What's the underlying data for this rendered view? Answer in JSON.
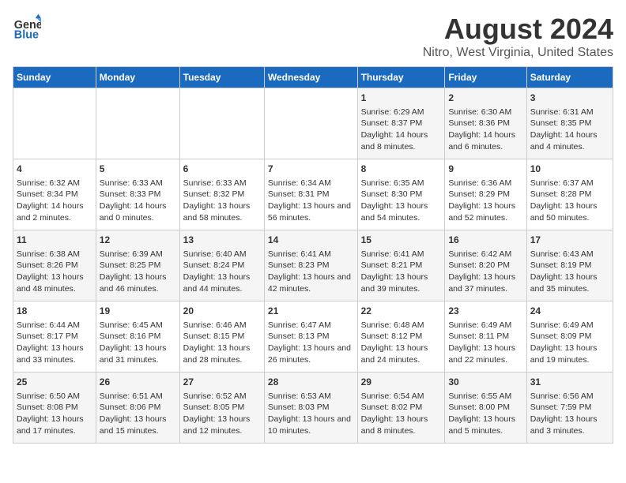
{
  "logo": {
    "line1": "General",
    "line2": "Blue"
  },
  "title": "August 2024",
  "subtitle": "Nitro, West Virginia, United States",
  "headers": [
    "Sunday",
    "Monday",
    "Tuesday",
    "Wednesday",
    "Thursday",
    "Friday",
    "Saturday"
  ],
  "weeks": [
    [
      {
        "day": "",
        "info": ""
      },
      {
        "day": "",
        "info": ""
      },
      {
        "day": "",
        "info": ""
      },
      {
        "day": "",
        "info": ""
      },
      {
        "day": "1",
        "info": "Sunrise: 6:29 AM\nSunset: 8:37 PM\nDaylight: 14 hours and 8 minutes."
      },
      {
        "day": "2",
        "info": "Sunrise: 6:30 AM\nSunset: 8:36 PM\nDaylight: 14 hours and 6 minutes."
      },
      {
        "day": "3",
        "info": "Sunrise: 6:31 AM\nSunset: 8:35 PM\nDaylight: 14 hours and 4 minutes."
      }
    ],
    [
      {
        "day": "4",
        "info": "Sunrise: 6:32 AM\nSunset: 8:34 PM\nDaylight: 14 hours and 2 minutes."
      },
      {
        "day": "5",
        "info": "Sunrise: 6:33 AM\nSunset: 8:33 PM\nDaylight: 14 hours and 0 minutes."
      },
      {
        "day": "6",
        "info": "Sunrise: 6:33 AM\nSunset: 8:32 PM\nDaylight: 13 hours and 58 minutes."
      },
      {
        "day": "7",
        "info": "Sunrise: 6:34 AM\nSunset: 8:31 PM\nDaylight: 13 hours and 56 minutes."
      },
      {
        "day": "8",
        "info": "Sunrise: 6:35 AM\nSunset: 8:30 PM\nDaylight: 13 hours and 54 minutes."
      },
      {
        "day": "9",
        "info": "Sunrise: 6:36 AM\nSunset: 8:29 PM\nDaylight: 13 hours and 52 minutes."
      },
      {
        "day": "10",
        "info": "Sunrise: 6:37 AM\nSunset: 8:28 PM\nDaylight: 13 hours and 50 minutes."
      }
    ],
    [
      {
        "day": "11",
        "info": "Sunrise: 6:38 AM\nSunset: 8:26 PM\nDaylight: 13 hours and 48 minutes."
      },
      {
        "day": "12",
        "info": "Sunrise: 6:39 AM\nSunset: 8:25 PM\nDaylight: 13 hours and 46 minutes."
      },
      {
        "day": "13",
        "info": "Sunrise: 6:40 AM\nSunset: 8:24 PM\nDaylight: 13 hours and 44 minutes."
      },
      {
        "day": "14",
        "info": "Sunrise: 6:41 AM\nSunset: 8:23 PM\nDaylight: 13 hours and 42 minutes."
      },
      {
        "day": "15",
        "info": "Sunrise: 6:41 AM\nSunset: 8:21 PM\nDaylight: 13 hours and 39 minutes."
      },
      {
        "day": "16",
        "info": "Sunrise: 6:42 AM\nSunset: 8:20 PM\nDaylight: 13 hours and 37 minutes."
      },
      {
        "day": "17",
        "info": "Sunrise: 6:43 AM\nSunset: 8:19 PM\nDaylight: 13 hours and 35 minutes."
      }
    ],
    [
      {
        "day": "18",
        "info": "Sunrise: 6:44 AM\nSunset: 8:17 PM\nDaylight: 13 hours and 33 minutes."
      },
      {
        "day": "19",
        "info": "Sunrise: 6:45 AM\nSunset: 8:16 PM\nDaylight: 13 hours and 31 minutes."
      },
      {
        "day": "20",
        "info": "Sunrise: 6:46 AM\nSunset: 8:15 PM\nDaylight: 13 hours and 28 minutes."
      },
      {
        "day": "21",
        "info": "Sunrise: 6:47 AM\nSunset: 8:13 PM\nDaylight: 13 hours and 26 minutes."
      },
      {
        "day": "22",
        "info": "Sunrise: 6:48 AM\nSunset: 8:12 PM\nDaylight: 13 hours and 24 minutes."
      },
      {
        "day": "23",
        "info": "Sunrise: 6:49 AM\nSunset: 8:11 PM\nDaylight: 13 hours and 22 minutes."
      },
      {
        "day": "24",
        "info": "Sunrise: 6:49 AM\nSunset: 8:09 PM\nDaylight: 13 hours and 19 minutes."
      }
    ],
    [
      {
        "day": "25",
        "info": "Sunrise: 6:50 AM\nSunset: 8:08 PM\nDaylight: 13 hours and 17 minutes."
      },
      {
        "day": "26",
        "info": "Sunrise: 6:51 AM\nSunset: 8:06 PM\nDaylight: 13 hours and 15 minutes."
      },
      {
        "day": "27",
        "info": "Sunrise: 6:52 AM\nSunset: 8:05 PM\nDaylight: 13 hours and 12 minutes."
      },
      {
        "day": "28",
        "info": "Sunrise: 6:53 AM\nSunset: 8:03 PM\nDaylight: 13 hours and 10 minutes."
      },
      {
        "day": "29",
        "info": "Sunrise: 6:54 AM\nSunset: 8:02 PM\nDaylight: 13 hours and 8 minutes."
      },
      {
        "day": "30",
        "info": "Sunrise: 6:55 AM\nSunset: 8:00 PM\nDaylight: 13 hours and 5 minutes."
      },
      {
        "day": "31",
        "info": "Sunrise: 6:56 AM\nSunset: 7:59 PM\nDaylight: 13 hours and 3 minutes."
      }
    ]
  ]
}
